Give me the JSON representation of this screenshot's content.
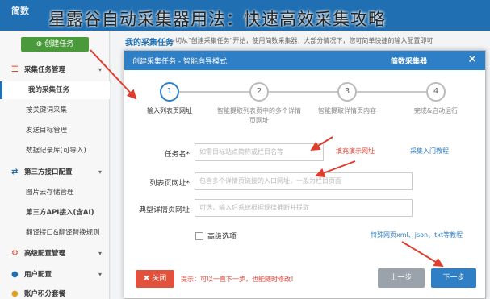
{
  "headline": "星露谷自动采集器用法：快速高效采集攻略",
  "topbar": {
    "logo": "简数"
  },
  "sidebar": {
    "create_button": "创建任务",
    "items": [
      {
        "label": "采集任务管理",
        "group": true,
        "icon": "list-icon"
      },
      {
        "label": "我的采集任务",
        "active": true
      },
      {
        "label": "按关键词采集"
      },
      {
        "label": "发送目标管理"
      },
      {
        "label": "数据记录库(可导入)"
      },
      {
        "label": "第三方接口配置",
        "group": true,
        "icon": "exchange-icon"
      },
      {
        "label": "图片云存储管理"
      },
      {
        "label": "第三方API接入(含AI)"
      },
      {
        "label": "翻译接口&翻译替换规则"
      },
      {
        "label": "高级配置管理",
        "group": true,
        "icon": "gear-icon"
      },
      {
        "label": "用户配置",
        "group": true,
        "icon": "user-icon"
      },
      {
        "label": "账户积分套餐",
        "group": true,
        "icon": "coin-icon"
      }
    ]
  },
  "main": {
    "title": "我的采集任务",
    "description": "—切从\"创建采集任务\"开始，使用简数采集器，大部分情况下，您可简单快捷的输入配置即可"
  },
  "modal": {
    "title": "创建采集任务 - 智能向导模式",
    "brand": "简数采集器",
    "close_glyph": "✕",
    "steps": [
      {
        "num": "1",
        "label": "输入列表页网址",
        "active": true
      },
      {
        "num": "2",
        "label": "智能提取列表页中的多个详情页网址",
        "active": false
      },
      {
        "num": "3",
        "label": "智能提取详情页内容",
        "active": false
      },
      {
        "num": "4",
        "label": "完成&启动运行",
        "active": false
      }
    ],
    "form": {
      "task_name_label": "任务名*",
      "task_name_placeholder": "如需目标站点简称或栏目名等",
      "task_name_note": "填充演示网址",
      "task_name_link": "采集入门教程",
      "list_url_label": "列表页网址*",
      "list_url_placeholder": "包含多个详情页链接的入口网址，一般为栏目页面",
      "detail_url_label": "典型详情页网址",
      "detail_url_placeholder": "可选，输入后系统根据规律推断并提取",
      "advanced_label": "高级选项",
      "formats_link": "特殊网页xml、json、txt等教程"
    },
    "footer": {
      "close_button": "✖ 关闭",
      "tip": "提示：可以一直下一步，也能随时修改！",
      "prev_button": "上一步",
      "next_button": "下一步"
    }
  },
  "colors": {
    "accent": "#2e7fc5",
    "danger": "#e2513b",
    "success": "#4a9a3b",
    "arrow": "#e03c2e"
  }
}
